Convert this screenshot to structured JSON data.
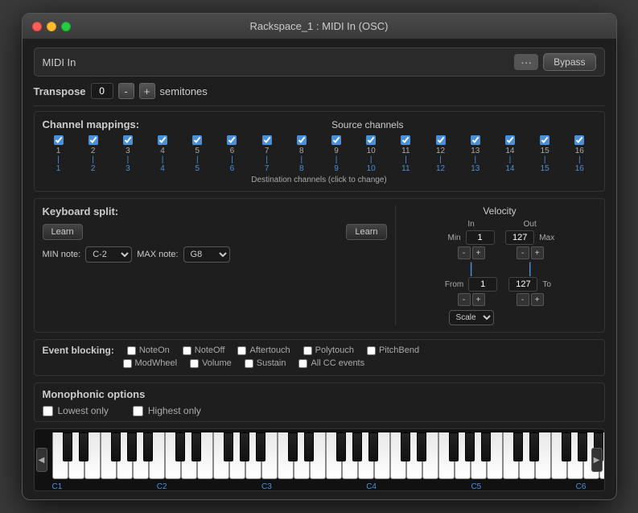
{
  "window": {
    "title": "Rackspace_1 : MIDI In (OSC)"
  },
  "header": {
    "midi_in_label": "MIDI In",
    "bypass_label": "Bypass",
    "dots_label": "···"
  },
  "transpose": {
    "label": "Transpose",
    "value": "0",
    "minus_label": "-",
    "plus_label": "+",
    "unit": "semitones"
  },
  "channel_mappings": {
    "title": "Channel mappings:",
    "source_title": "Source channels",
    "channels": [
      1,
      2,
      3,
      4,
      5,
      6,
      7,
      8,
      9,
      10,
      11,
      12,
      13,
      14,
      15,
      16
    ],
    "dest_label": "Destination channels (click to change)"
  },
  "keyboard_split": {
    "title": "Keyboard split:",
    "learn1_label": "Learn",
    "learn2_label": "Learn",
    "min_label": "MIN note:",
    "min_value": "C-2",
    "max_label": "MAX note:",
    "max_value": "G8"
  },
  "velocity": {
    "title": "Velocity",
    "min_label": "Min",
    "min_value": "1",
    "max_label": "Max",
    "max_value": "127",
    "in_label": "In",
    "out_label": "Out",
    "from_label": "From",
    "from_value": "1",
    "to_label": "To",
    "to_value": "127",
    "scale_label": "Scale"
  },
  "event_blocking": {
    "label": "Event blocking:",
    "items_row1": [
      "NoteOn",
      "NoteOff",
      "Aftertouch",
      "Polytouch",
      "PitchBend"
    ],
    "items_row2": [
      "ModWheel",
      "Volume",
      "Sustain",
      "All CC events"
    ]
  },
  "monophonic": {
    "title": "Monophonic options",
    "lowest_label": "Lowest only",
    "highest_label": "Highest only"
  },
  "piano": {
    "labels": [
      "C1",
      "C2",
      "C3",
      "C4",
      "C5",
      "C6"
    ]
  }
}
